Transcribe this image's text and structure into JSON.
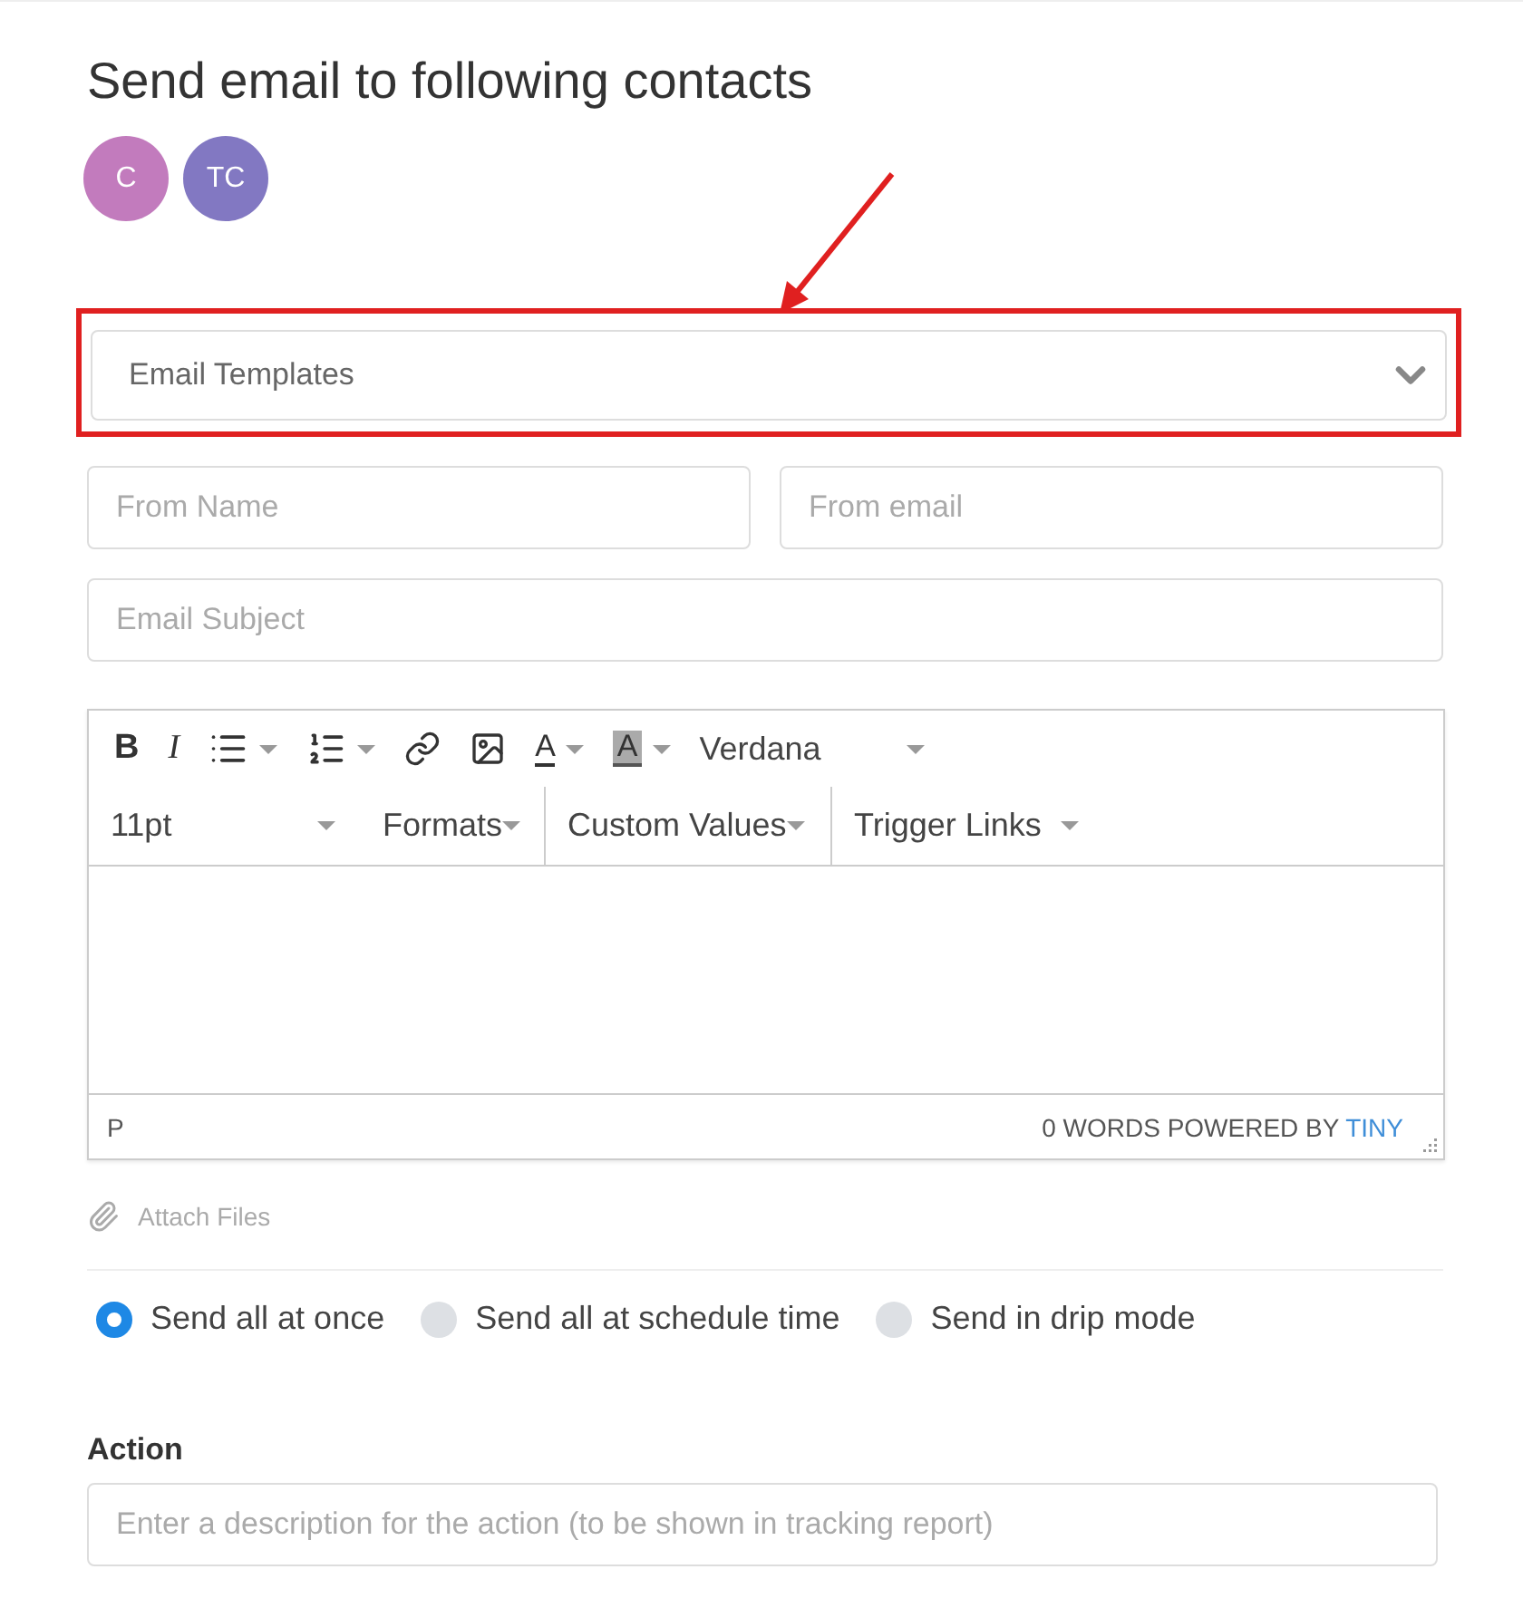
{
  "title": "Send email to following contacts",
  "contacts": [
    {
      "initials": "C",
      "color": "#c27bbd"
    },
    {
      "initials": "TC",
      "color": "#8278c2"
    }
  ],
  "template_select": {
    "placeholder": "Email Templates"
  },
  "fields": [
    {
      "placeholder": "From Name"
    },
    {
      "placeholder": "From email"
    }
  ],
  "subject": {
    "placeholder": "Email Subject"
  },
  "editor": {
    "toolbar_row_1": [
      {
        "kind": "bold",
        "label": "B"
      },
      {
        "kind": "italic",
        "label": "I"
      },
      {
        "kind": "bullets"
      },
      {
        "kind": "numbers"
      },
      {
        "kind": "link"
      },
      {
        "kind": "image"
      },
      {
        "kind": "textcolor",
        "label": "A"
      },
      {
        "kind": "bgcolor",
        "label": "A"
      },
      {
        "kind": "font",
        "label": "Verdana"
      }
    ],
    "toolbar_row_2": [
      {
        "label": "11pt"
      },
      {
        "label": "Formats"
      },
      {
        "label": "Custom Values"
      },
      {
        "label": "Trigger Links"
      }
    ],
    "path": "P",
    "status": "0 WORDS POWERED BY ",
    "brand": "TINY"
  },
  "attach": "Attach Files",
  "send_modes": [
    {
      "label": "Send all at once",
      "selected": true
    },
    {
      "label": "Send all at schedule time",
      "selected": false
    },
    {
      "label": "Send in drip mode",
      "selected": false
    }
  ],
  "action": {
    "label": "Action",
    "placeholder": "Enter a description for the action (to be shown in tracking report)"
  }
}
